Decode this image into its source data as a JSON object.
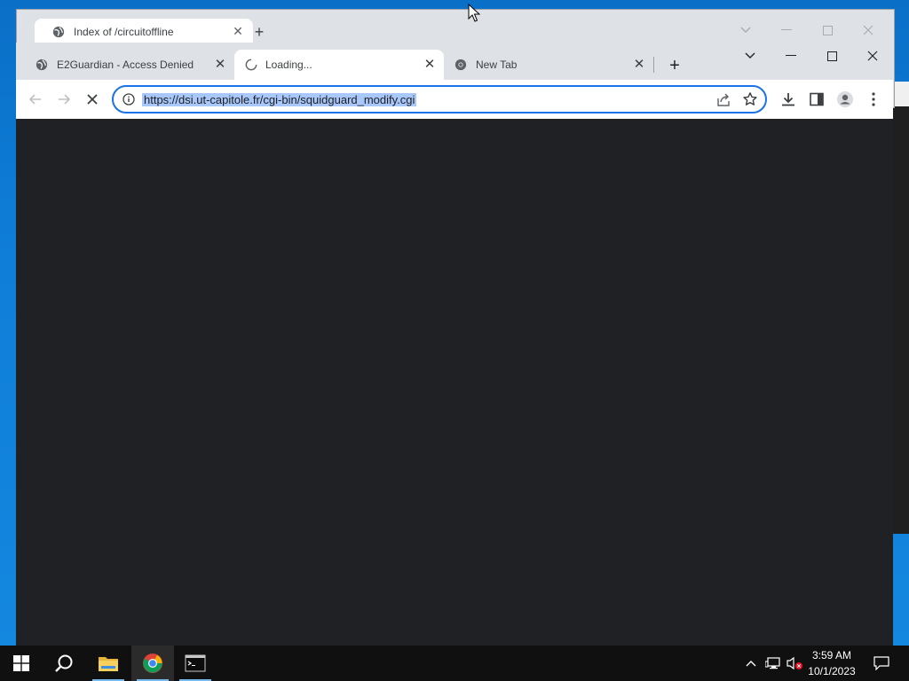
{
  "background_window": {
    "tab": {
      "title": "Index of /circuitoffline"
    },
    "new_tab_label": "+"
  },
  "browser": {
    "tabs": [
      {
        "title": "E2Guardian - Access Denied",
        "active": false
      },
      {
        "title": "Loading...",
        "active": true
      },
      {
        "title": "New Tab",
        "active": false
      }
    ],
    "new_tab_label": "+",
    "address_bar": {
      "url": "https://dsi.ut-capitole.fr/cgi-bin/squidguard_modify.cgi"
    }
  },
  "taskbar": {
    "apps": [
      "start",
      "search",
      "file-explorer",
      "chrome",
      "terminal"
    ],
    "clock": {
      "time": "3:59 AM",
      "date": "10/1/2023"
    }
  },
  "colors": {
    "accent": "#1a73e8",
    "selection": "#a8c7fa",
    "page_background": "#202124",
    "tabstrip": "#dee1e6"
  }
}
